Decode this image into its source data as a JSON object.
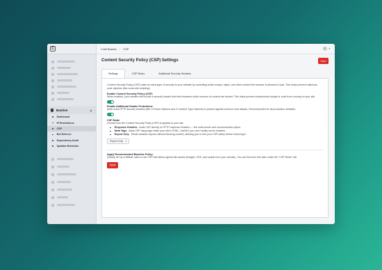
{
  "app": {
    "logo_letter": "C"
  },
  "breadcrumb": {
    "parent": "Craft Bastion",
    "current": "CSP"
  },
  "user": {
    "avatar_letter": "F"
  },
  "sidebar": {
    "section_label": "Bastion",
    "items": [
      {
        "label": "Dashboard",
        "active": false
      },
      {
        "label": "IP Restrictions",
        "active": false
      },
      {
        "label": "CSP",
        "active": true
      },
      {
        "label": "Bot Defence",
        "active": false
      },
      {
        "label": "Dependency Audit",
        "active": false
      },
      {
        "label": "Updates Reminder",
        "active": false
      }
    ]
  },
  "page": {
    "title": "Content Security Policy (CSP) Settings",
    "save_label": "Save"
  },
  "tabs": [
    {
      "label": "Settings",
      "active": true
    },
    {
      "label": "CSP Rules",
      "active": false
    },
    {
      "label": "Additional Security Headers",
      "active": false
    }
  ],
  "settings": {
    "intro": "Content Security Policy (CSP) adds an extra layer of security to your website by controlling which scripts, styles, and other content the browser is allowed to load. This helps prevent malicious code injection (like cross-site scripting).",
    "enable_csp": {
      "label": "Enable Content Security Policy (CSP)",
      "description": "When enabled, your website will include a security header that tells browsers which sources of content are trusted. This helps prevent unauthorized scripts or code from running on your site.",
      "enabled": true
    },
    "enable_headers": {
      "label": "Enable Additional Header Protections",
      "description": "Adds extra HTTP security headers (like X-Frame-Options and X-Content-Type-Options) to protect against common web attacks. Recommended for all production websites.",
      "enabled": true
    },
    "csp_mode": {
      "label": "CSP Mode",
      "description": "Choose how the Content Security Policy (CSP) is applied to your site.",
      "options": [
        {
          "name": "Response Headers:",
          "text": "Adds CSP directly to HTTP response headers — the most secure and recommended option."
        },
        {
          "name": "Meta Tags:",
          "text": "Adds CSP using tags inside your site's HTML. Useful if you can't modify server headers."
        },
        {
          "name": "Report Only:",
          "text": "Sends violation reports without blocking content, allowing you to test your CSP safely before enforcing it."
        }
      ],
      "selected": "Report Only"
    },
    "baseline": {
      "label": "Apply Recommended Baseline Policy",
      "description": "Quickly set up a default, safe-to-use CSP that allows typical site assets (images, CSS, and scripts from your domain). You can fine-tune this later under the \"CSP Rules\" tab.",
      "apply_label": "Apply"
    }
  },
  "colors": {
    "accent": "#d92d26",
    "toggle_on": "#1d9e73"
  }
}
